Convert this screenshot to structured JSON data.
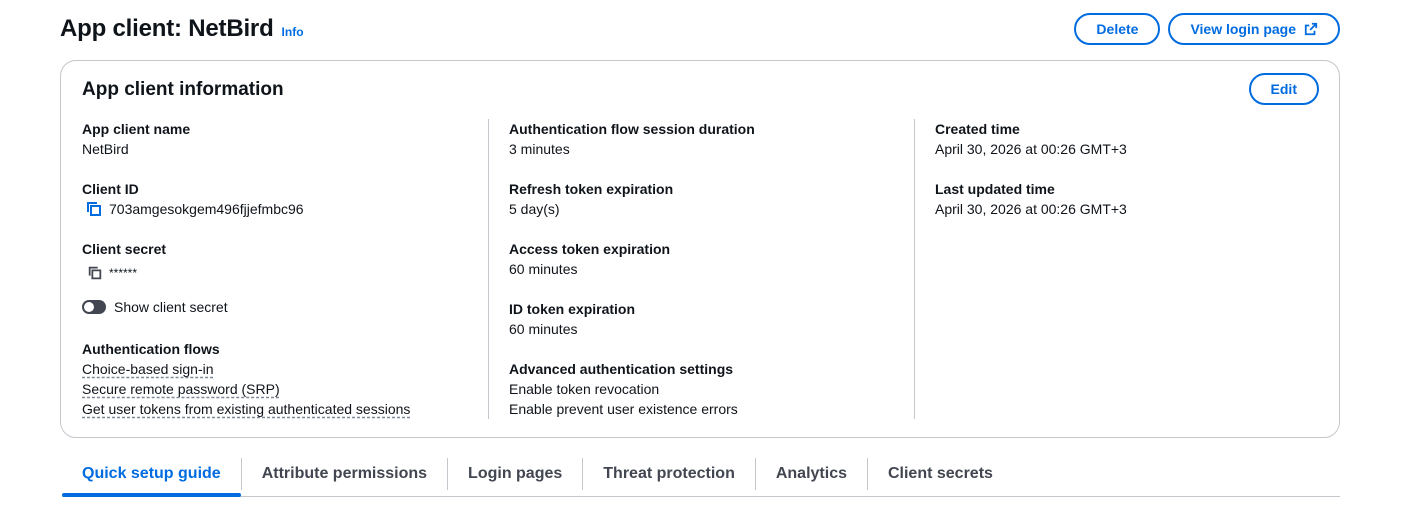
{
  "header": {
    "title": "App client: NetBird",
    "info": "Info",
    "delete_label": "Delete",
    "view_login_label": "View login page"
  },
  "card": {
    "title": "App client information",
    "edit_label": "Edit",
    "col1": {
      "app_client_name_label": "App client name",
      "app_client_name": "NetBird",
      "client_id_label": "Client ID",
      "client_id": "703amgesokgem496fjjefmbc96",
      "client_secret_label": "Client secret",
      "client_secret": "******",
      "show_secret_label": "Show client secret",
      "auth_flows_label": "Authentication flows",
      "auth_flows": [
        "Choice-based sign-in",
        "Secure remote password (SRP)",
        "Get user tokens from existing authenticated sessions"
      ]
    },
    "col2": {
      "session_duration_label": "Authentication flow session duration",
      "session_duration": "3 minutes",
      "refresh_label": "Refresh token expiration",
      "refresh": "5 day(s)",
      "access_label": "Access token expiration",
      "access": "60 minutes",
      "id_label": "ID token expiration",
      "id": "60 minutes",
      "advanced_label": "Advanced authentication settings",
      "advanced": [
        "Enable token revocation",
        "Enable prevent user existence errors"
      ]
    },
    "col3": {
      "created_label": "Created time",
      "created": "April 30, 2026 at 00:26 GMT+3",
      "updated_label": "Last updated time",
      "updated": "April 30, 2026 at 00:26 GMT+3"
    }
  },
  "tabs": [
    "Quick setup guide",
    "Attribute permissions",
    "Login pages",
    "Threat protection",
    "Analytics",
    "Client secrets"
  ],
  "colors": {
    "accent": "#006ce0",
    "text": "#0f141a",
    "border": "#c6c6cd"
  },
  "icons": {
    "copy": "copy-icon",
    "external": "external-link-icon",
    "toggle": "toggle-off"
  },
  "state": {
    "show_client_secret": false,
    "active_tab": "Quick setup guide"
  }
}
